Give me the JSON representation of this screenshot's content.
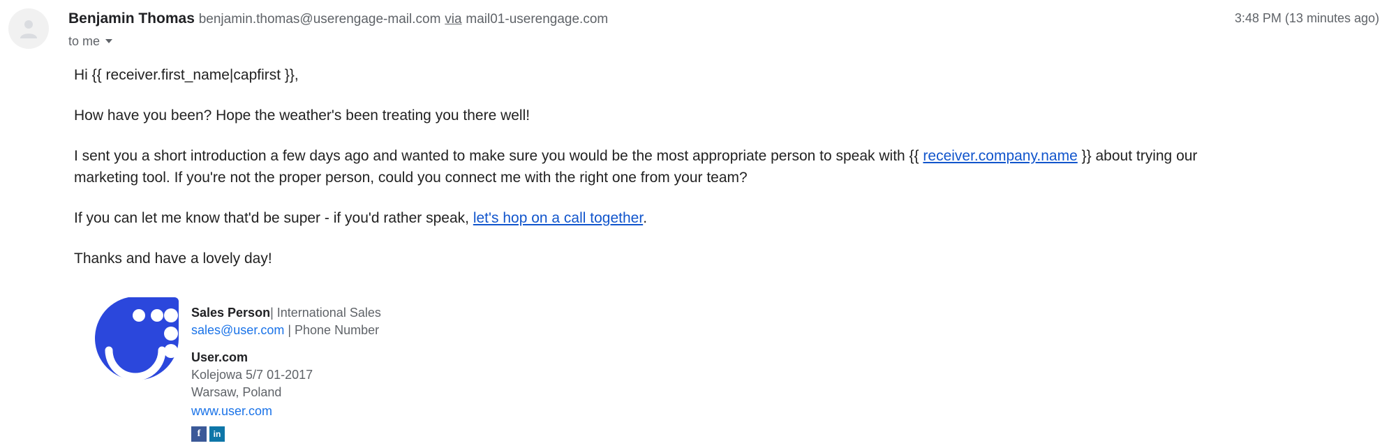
{
  "header": {
    "avatar_icon": "person-placeholder-icon",
    "sender_name": "Benjamin Thomas",
    "sender_email": "benjamin.thomas@userengage-mail.com",
    "via_label": "via",
    "via_host": "mail01-userengage.com",
    "recipient_label": "to me",
    "timestamp": "3:48 PM (13 minutes ago)"
  },
  "body": {
    "greeting": "Hi {{ receiver.first_name|capfirst }},",
    "paragraph_1": "How have you been? Hope the weather's been treating you there well!",
    "paragraph_2_before": "I sent you a short introduction a few days ago and wanted to make sure you would be the most appropriate person to speak with {{ ",
    "paragraph_2_link": "receiver.company.name",
    "paragraph_2_after": " }} about trying our marketing tool. If you're not the proper person, could you connect me with the right one from your team?",
    "paragraph_3_before": "If you can let me know that'd be super - if you'd rather speak, ",
    "paragraph_3_link": "let's hop on a call together",
    "paragraph_3_after": ".",
    "closing": "Thanks and have a lovely day!"
  },
  "signature": {
    "logo_icon": "user-com-smiley-logo",
    "person_name": "Sales Person",
    "name_separator": "|",
    "person_title": " International Sales",
    "email": "sales@user.com",
    "contact_separator": " | ",
    "phone": "Phone Number",
    "company": "User.com",
    "address_line_1": "Kolejowa 5/7 01-2017",
    "address_line_2": "Warsaw, Poland",
    "website": "www.user.com",
    "social": [
      {
        "name": "facebook-icon",
        "glyph": "f"
      },
      {
        "name": "linkedin-icon",
        "glyph": "in"
      }
    ]
  },
  "colors": {
    "link_blue": "#1155cc",
    "sig_link_blue": "#1a73e8",
    "logo_blue": "#2b47dc",
    "facebook_blue": "#3b5998",
    "linkedin_blue": "#0e76a8",
    "muted_text": "#5f6368"
  }
}
